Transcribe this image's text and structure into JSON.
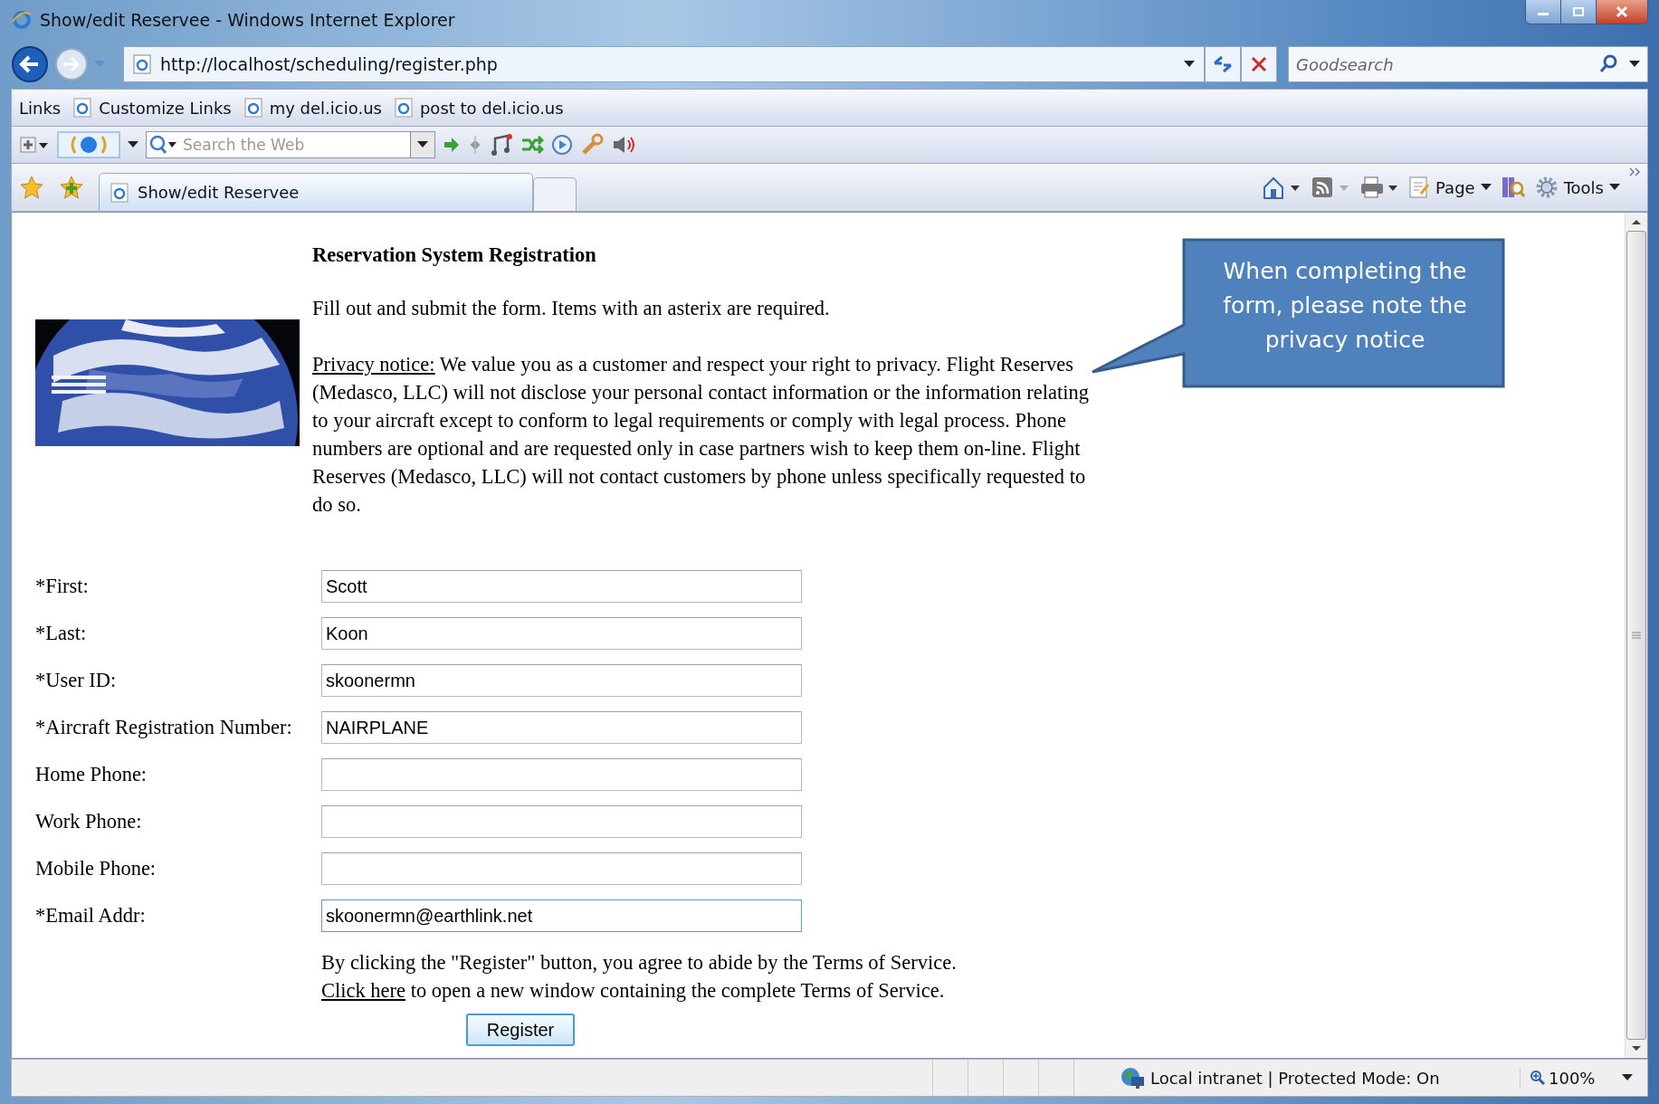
{
  "window": {
    "title": "Show/edit Reservee - Windows Internet Explorer"
  },
  "address_bar": {
    "url": "http://localhost/scheduling/register.php"
  },
  "search_box": {
    "placeholder": "Goodsearch"
  },
  "links_bar": {
    "label": "Links",
    "items": [
      "Customize Links",
      "my del.icio.us",
      "post to del.icio.us"
    ]
  },
  "toolbar": {
    "search_placeholder": "Search the Web"
  },
  "tabs": [
    {
      "label": "Show/edit Reservee",
      "selected": true
    }
  ],
  "command_bar": [
    "Page",
    "Tools"
  ],
  "page": {
    "heading": "Reservation System Registration",
    "intro": "Fill out and submit the form. Items with an asterix are required.",
    "privacy_link": "Privacy notice:",
    "privacy_text": "We value you as a customer and respect your right to privacy. Flight Reserves (Medasco, LLC) will not disclose your personal contact information or the information relating to your aircraft except to conform to legal requirements or comply with legal process. Phone numbers are optional and are requested only in case partners wish to keep them on-line. Flight Reserves (Medasco, LLC) will not contact customers by phone unless specifically requested to do so.",
    "fields": [
      {
        "label": "*First:",
        "value": "Scott",
        "focused": false
      },
      {
        "label": "*Last:",
        "value": "Koon",
        "focused": false
      },
      {
        "label": "*User ID:",
        "value": "skoonermn",
        "focused": false
      },
      {
        "label": "*Aircraft Registration Number:",
        "value": "NAIRPLANE",
        "focused": false
      },
      {
        "label": "Home Phone:",
        "focused": false
      },
      {
        "label": "Work Phone:",
        "focused": false
      },
      {
        "label": "Mobile Phone:",
        "focused": false
      },
      {
        "label": "*Email Addr:",
        "value": "skoonermn@earthlink.net",
        "focused": true
      }
    ],
    "terms_text": "By clicking the \"Register\" button, you agree to abide by the Terms of Service.",
    "terms_link": "Click here",
    "terms_rest": "to open a new window containing the complete Terms of Service.",
    "button": "Register"
  },
  "callout": {
    "text": "When completing the form, please note the privacy notice"
  },
  "status_bar": {
    "zone": "Local intranet | Protected Mode: On",
    "zoom": "100%"
  }
}
